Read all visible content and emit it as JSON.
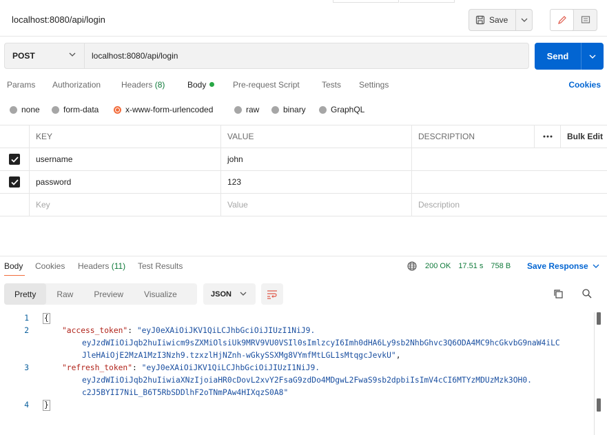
{
  "request": {
    "title": "localhost:8080/api/login",
    "save_label": "Save",
    "method": "POST",
    "url": "localhost:8080/api/login",
    "send_label": "Send"
  },
  "request_tabs": {
    "params": "Params",
    "authorization": "Authorization",
    "headers": "Headers",
    "headers_count": "(8)",
    "body": "Body",
    "pre_request": "Pre-request Script",
    "tests": "Tests",
    "settings": "Settings",
    "cookies": "Cookies"
  },
  "body_types": {
    "none": "none",
    "form_data": "form-data",
    "urlencoded": "x-www-form-urlencoded",
    "raw": "raw",
    "binary": "binary",
    "graphql": "GraphQL",
    "selected": "x-www-form-urlencoded"
  },
  "table": {
    "headers": {
      "key": "KEY",
      "value": "VALUE",
      "description": "DESCRIPTION",
      "bulk_edit": "Bulk Edit"
    },
    "rows": [
      {
        "key": "username",
        "value": "john",
        "checked": true
      },
      {
        "key": "password",
        "value": "123",
        "checked": true
      }
    ],
    "placeholders": {
      "key": "Key",
      "value": "Value",
      "description": "Description"
    }
  },
  "response_tabs": {
    "body": "Body",
    "cookies": "Cookies",
    "headers": "Headers",
    "headers_count": "(11)",
    "test_results": "Test Results"
  },
  "response_status": {
    "status": "200 OK",
    "time": "17.51 s",
    "size": "758 B",
    "save_response": "Save Response"
  },
  "view_modes": {
    "pretty": "Pretty",
    "raw": "Raw",
    "preview": "Preview",
    "visualize": "Visualize",
    "format": "JSON"
  },
  "code": {
    "line_numbers": [
      "1",
      "2",
      "3",
      "4"
    ],
    "open_brace": "{",
    "close_brace": "}",
    "access_key": "\"access_token\"",
    "access_val_1": "\"eyJ0eXAiOiJKV1QiLCJhbGciOiJIUzI1NiJ9.",
    "access_val_2": "eyJzdWIiOiJqb2huIiwicm9sZXMiOlsiUk9MRV9VU0VSIl0sImlzcyI6Imh0dHA6Ly9sb2NhbGhvc3Q6ODA4MC9hcGkvbG9naW4iLC",
    "access_val_3": "JleHAiOjE2MzA1MzI3Nzh9.tzxzlHjNZnh-wGkySSXMg8VYmfMtLGL1sMtqgcJevkU\"",
    "refresh_key": "\"refresh_token\"",
    "refresh_val_1": "\"eyJ0eXAiOiJKV1QiLCJhbGciOiJIUzI1NiJ9.",
    "refresh_val_2": "eyJzdWIiOiJqb2huIiwiaXNzIjoiaHR0cDovL2xvY2FsaG9zdDo4MDgwL2FwaS9sb2dpbiIsImV4cCI6MTYzMDUzMzk3OH0.",
    "refresh_val_3": "c2J5BYII7NiL_B6T5RbSDDlhF2oTNmPAw4HIXqzS0A8\""
  },
  "colors": {
    "accent": "#f26b3a",
    "primary": "#0265d2",
    "success": "#0f7a3a"
  }
}
